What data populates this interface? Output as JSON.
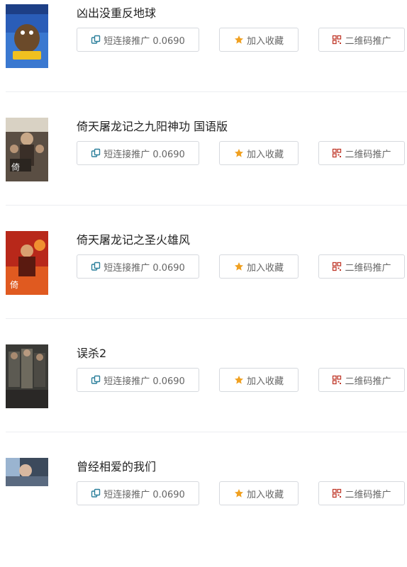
{
  "buttons": {
    "short_link_label": "短连接推广 0.0690",
    "favorite_label": "加入收藏",
    "qrcode_label": "二维码推广"
  },
  "items": [
    {
      "title": "凶出没重反地球",
      "icons": [
        "link-icon",
        "star-icon",
        "qrcode-icon"
      ]
    },
    {
      "title": "倚天屠龙记之九阳神功 国语版",
      "icons": [
        "link-icon",
        "star-icon",
        "qrcode-icon"
      ]
    },
    {
      "title": "倚天屠龙记之圣火雄风",
      "icons": [
        "link-icon",
        "star-icon",
        "qrcode-icon"
      ]
    },
    {
      "title": "误杀2",
      "icons": [
        "link-icon",
        "star-icon",
        "qrcode-icon"
      ]
    },
    {
      "title": "曾经相爱的我们",
      "icons": [
        "link-icon",
        "star-icon",
        "qrcode-icon"
      ]
    }
  ],
  "colors": {
    "link_icon": "#2a7f9b",
    "star_icon": "#f0a020",
    "qrcode_icon": "#c0392b",
    "button_border": "#d6d9de",
    "separator": "#eceef1"
  }
}
